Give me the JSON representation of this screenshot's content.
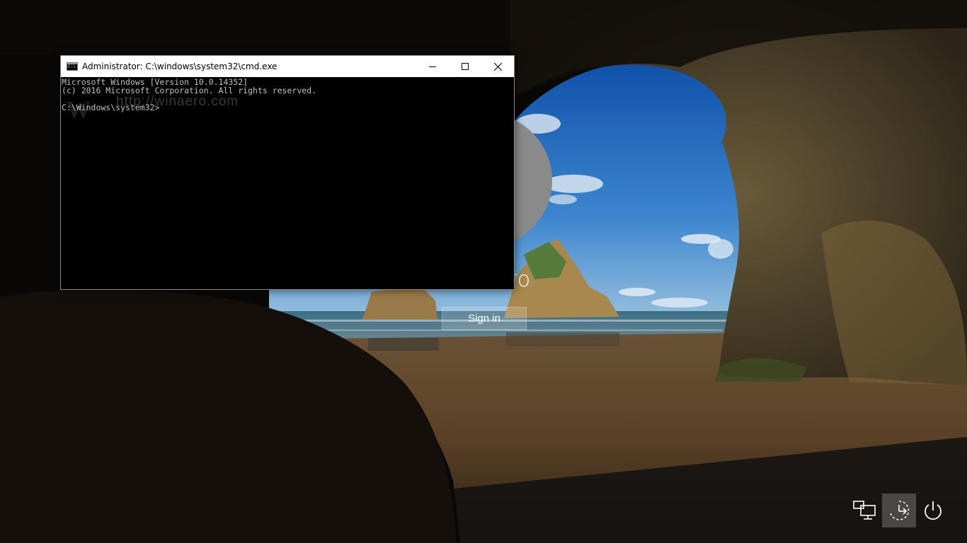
{
  "lock_screen": {
    "username": "Winaero",
    "sign_in_label": "Sign in"
  },
  "cmd_window": {
    "title": "Administrator: C:\\windows\\system32\\cmd.exe",
    "lines": [
      "Microsoft Windows [Version 10.0.14352]",
      "(c) 2016 Microsoft Corporation. All rights reserved.",
      "",
      "C:\\Windows\\system32>"
    ],
    "watermark": "http://winaero.com",
    "watermark_letter": "W"
  },
  "tray": {
    "network_icon": "network-icon",
    "ease_of_access_icon": "ease-of-access-icon",
    "power_icon": "power-icon"
  },
  "colors": {
    "console_text": "#c0c0c0",
    "console_bg": "#000000",
    "titlebar": "#ffffff",
    "avatar": "#8a8a8a"
  }
}
